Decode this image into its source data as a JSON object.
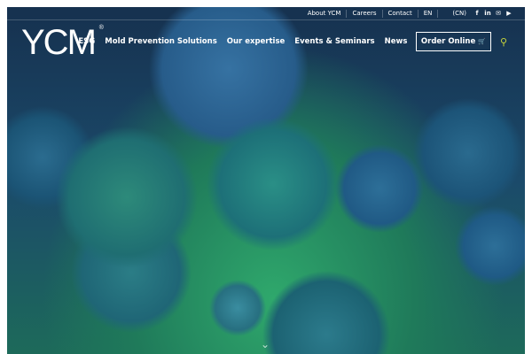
{
  "topbar": {
    "links": [
      "About YCM",
      "Careers",
      "Contact",
      "EN",
      "(CN)"
    ],
    "social": [
      "facebook-icon",
      "linkedin-icon",
      "email-icon",
      "youtube-icon"
    ]
  },
  "logo": {
    "text": "YCM",
    "mark": "®"
  },
  "nav": {
    "items": [
      "ESG",
      "Mold Prevention Solutions",
      "Our expertise",
      "Events & Seminars",
      "News"
    ],
    "order": "Order Online",
    "cart_icon": "🛒",
    "search_icon": "⚲"
  },
  "hero": {
    "scroll_icon": "⌄"
  }
}
